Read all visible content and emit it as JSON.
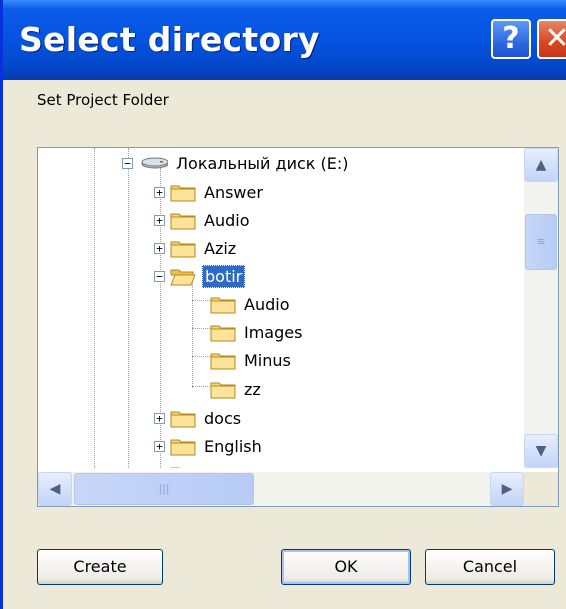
{
  "window": {
    "title": "Select directory",
    "help_label": "?",
    "close_label": "✕",
    "subtitle": "Set Project Folder"
  },
  "tree": {
    "root": {
      "label": "Локальный диск (E:)",
      "icon": "hard-drive-icon",
      "expanded": true
    },
    "folders": [
      {
        "label": "Answer",
        "level": 1,
        "expander": "+"
      },
      {
        "label": "Audio",
        "level": 1,
        "expander": "+"
      },
      {
        "label": "Aziz",
        "level": 1,
        "expander": "+"
      },
      {
        "label": "botir",
        "level": 1,
        "expander": "−",
        "selected": true
      },
      {
        "label": "Audio",
        "level": 2,
        "expander": ""
      },
      {
        "label": "Images",
        "level": 2,
        "expander": ""
      },
      {
        "label": "Minus",
        "level": 2,
        "expander": ""
      },
      {
        "label": "zz",
        "level": 2,
        "expander": ""
      },
      {
        "label": "docs",
        "level": 1,
        "expander": "+"
      },
      {
        "label": "English",
        "level": 1,
        "expander": "+"
      }
    ]
  },
  "scrollbars": {
    "up_arrow": "▲",
    "down_arrow": "▼",
    "left_arrow": "◀",
    "right_arrow": "▶",
    "thumb_grip_v": "≡",
    "thumb_grip_h": "|||"
  },
  "buttons": {
    "create": "Create",
    "ok": "OK",
    "cancel": "Cancel"
  },
  "colors": {
    "titlebar": "#0553E0",
    "selection": "#316AC5",
    "dialog_bg": "#ECE9D8",
    "folder": "#F7D774"
  }
}
